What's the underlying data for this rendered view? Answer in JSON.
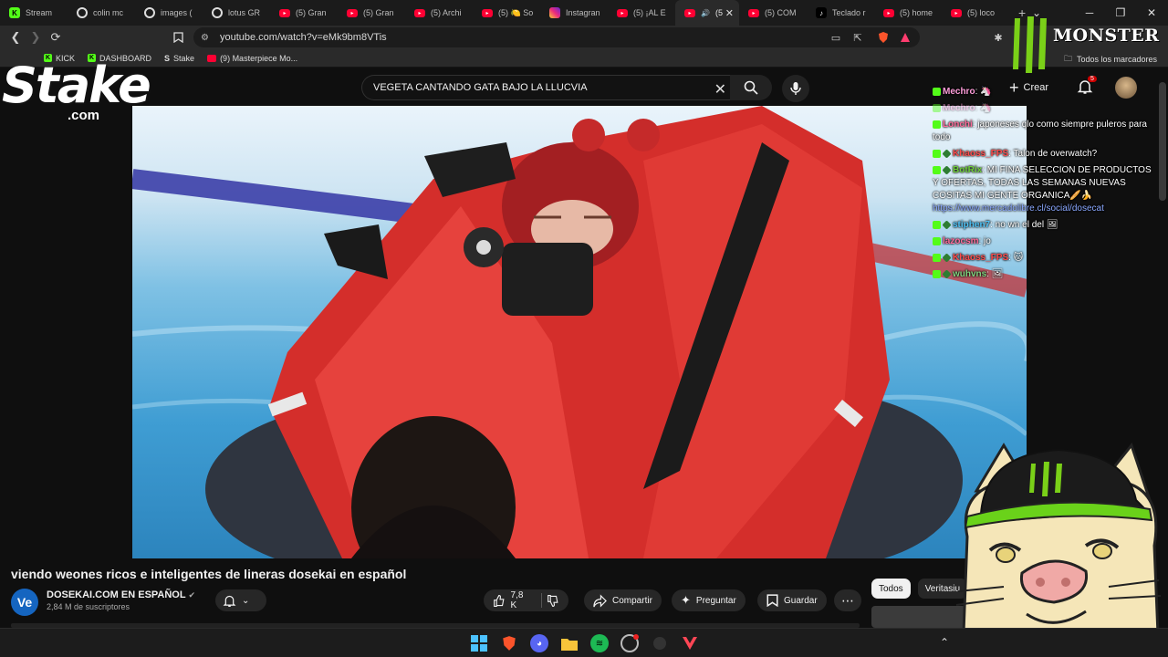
{
  "browser": {
    "tabs": [
      {
        "title": "Stream",
        "icon": "kick-icon",
        "color": "#53fc18"
      },
      {
        "title": "colin mc",
        "icon": "google-icon",
        "color": "#dddddd"
      },
      {
        "title": "images (",
        "icon": "google-lens-icon",
        "color": "#dddddd"
      },
      {
        "title": "lotus GR",
        "icon": "google-icon",
        "color": "#dddddd"
      },
      {
        "title": "(5) Gran",
        "icon": "youtube-icon",
        "color": "#ff0033"
      },
      {
        "title": "(5) Gran",
        "icon": "youtube-icon",
        "color": "#ff0033"
      },
      {
        "title": "(5) Archi",
        "icon": "youtube-icon",
        "color": "#ff0033"
      },
      {
        "title": "(5) 🍋 So",
        "icon": "youtube-icon",
        "color": "#ff0033"
      },
      {
        "title": "Instagran",
        "icon": "instagram-icon",
        "color": "#e1306c"
      },
      {
        "title": "(5) ¡AL E",
        "icon": "youtube-icon",
        "color": "#ff0033"
      },
      {
        "title": "(5",
        "icon": "youtube-icon",
        "color": "#ff0033",
        "active": true
      },
      {
        "title": "(5) COM",
        "icon": "youtube-icon",
        "color": "#ff0033"
      },
      {
        "title": "Teclado r",
        "icon": "tiktok-icon",
        "color": "#ffffff"
      },
      {
        "title": "(5) home",
        "icon": "youtube-icon",
        "color": "#ff0033"
      },
      {
        "title": "(5) loco",
        "icon": "youtube-icon",
        "color": "#ff0033"
      }
    ],
    "url": "youtube.com/watch?v=eMk9bm8VTis",
    "bookmarks": [
      {
        "label": "KICK",
        "icon": "kick-icon"
      },
      {
        "label": "DASHBOARD",
        "icon": "kick-icon"
      },
      {
        "label": "Stake",
        "icon": "stake-icon"
      },
      {
        "label": "(9) Masterpiece Mo...",
        "icon": "youtube-icon"
      }
    ],
    "all_bookmarks": "Todos los marcadores"
  },
  "youtube": {
    "search_query": "VEGETA CANTANDO GATA BAJO LA LLUCVIA",
    "create_label": "Crear",
    "notifications_count": "5",
    "video_title": "viendo weones ricos e inteligentes de lineras dosekai en español",
    "channel": {
      "avatar_text": "Ve",
      "name": "DOSEKAI.COM  EN ESPAÑOL",
      "subscribers": "2,84 M de suscriptores"
    },
    "actions": {
      "likes": "7,8 K",
      "share": "Compartir",
      "ask": "Preguntar",
      "save": "Guardar"
    },
    "chips": [
      "Todos",
      "Veritasiu"
    ]
  },
  "overlay": {
    "stake_logo": "Stake",
    "stake_domain": ".com",
    "monster_logo": "MONSTER",
    "chat": [
      {
        "user": "Mechro",
        "user_color": "#ff9edb",
        "text": ": 🦄",
        "faint": false
      },
      {
        "user": "Mechro",
        "user_color": "#ff9edb",
        "text": ": 🦄",
        "faint": true
      },
      {
        "user": "Lonchi",
        "user_color": "#ff6b9a",
        "text": ": japoneses qlo como siempre puleros para todo",
        "faint": false
      },
      {
        "user": "Khaoss_FPS",
        "user_color": "#ff4d4d",
        "text": ": Talon de overwatch?",
        "faint": false
      },
      {
        "user": "BotRix",
        "user_color": "#6fcf3a",
        "text": ": MI FINA SELECCION DE PRODUCTOS Y OFERTAS, TODAS LAS SEMANAS NUEVAS COSITAS MI GENTE ORGANICA🥖🍌",
        "link": "https://www.mercadolibre.cl/social/dosecat",
        "faint": false
      },
      {
        "user": "stiphen7",
        "user_color": "#4fc3f7",
        "text": ": no wn el del 🖼",
        "faint": false
      },
      {
        "user": "lazocsm",
        "user_color": "#ff6b9a",
        "text": ": jo",
        "faint": false
      },
      {
        "user": "Khaoss_FPS",
        "user_color": "#ff4d4d",
        "text": ": 🐱",
        "faint": false
      },
      {
        "user": "wuhvns",
        "user_color": "#7fd37f",
        "text": ": 🖼",
        "faint": false
      }
    ]
  },
  "colors": {
    "kick_green": "#53fc18",
    "youtube_red": "#ff0033",
    "raft_red": "#e2332e"
  }
}
